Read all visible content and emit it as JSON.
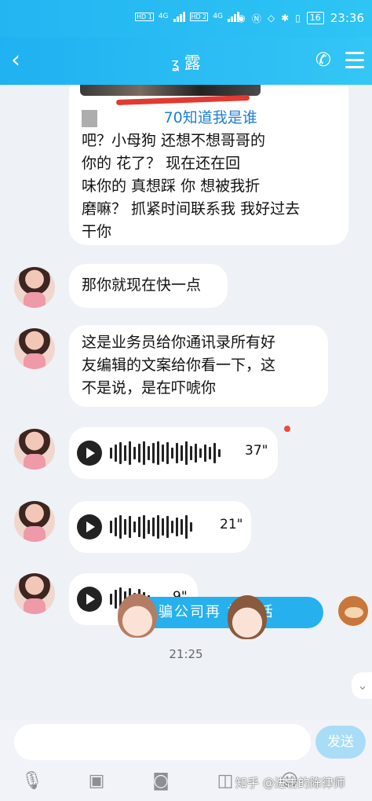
{
  "status_bar": {
    "sim1_tag": "HD 1",
    "sim2_tag": "HD 2",
    "network1": "4G",
    "network2": "4G",
    "battery": "16",
    "time": "23:36"
  },
  "header": {
    "title": "露",
    "back_icon": "chevron-left-icon",
    "call_icon": "phone-icon",
    "menu_icon": "menu-icon"
  },
  "messages": {
    "first": {
      "line1_suffix": "70知道我是谁",
      "line2": "吧？小母狗  还想不想哥哥的",
      "line3": "你的 花了？  现在还在回",
      "line4": "味你的  真想踩 你  想被我折",
      "line5": "磨嘛？  抓紧时间联系我  我好过去",
      "line6": "干你"
    },
    "second": "那你就现在快一点",
    "third": [
      "这是业务员给你通讯录所有好",
      "友编辑的文案给你看一下，这",
      "不是说，是在吓唬你"
    ],
    "voice1": "37\"",
    "voice2": "21\"",
    "voice3": "9\""
  },
  "timestamp": "21:25",
  "sticker_text": "骗公司再    打电话",
  "input": {
    "placeholder": "",
    "send_label": "发送"
  },
  "toolbar": [
    "microphone-icon",
    "image-icon",
    "camera-icon",
    "red-packet-icon",
    "emoji-icon"
  ],
  "watermark": "知乎 @进击的陈律师",
  "colors": {
    "header": "#23b5f2",
    "send_button": "#a9ddf7",
    "unread_dot": "#f2483a"
  }
}
